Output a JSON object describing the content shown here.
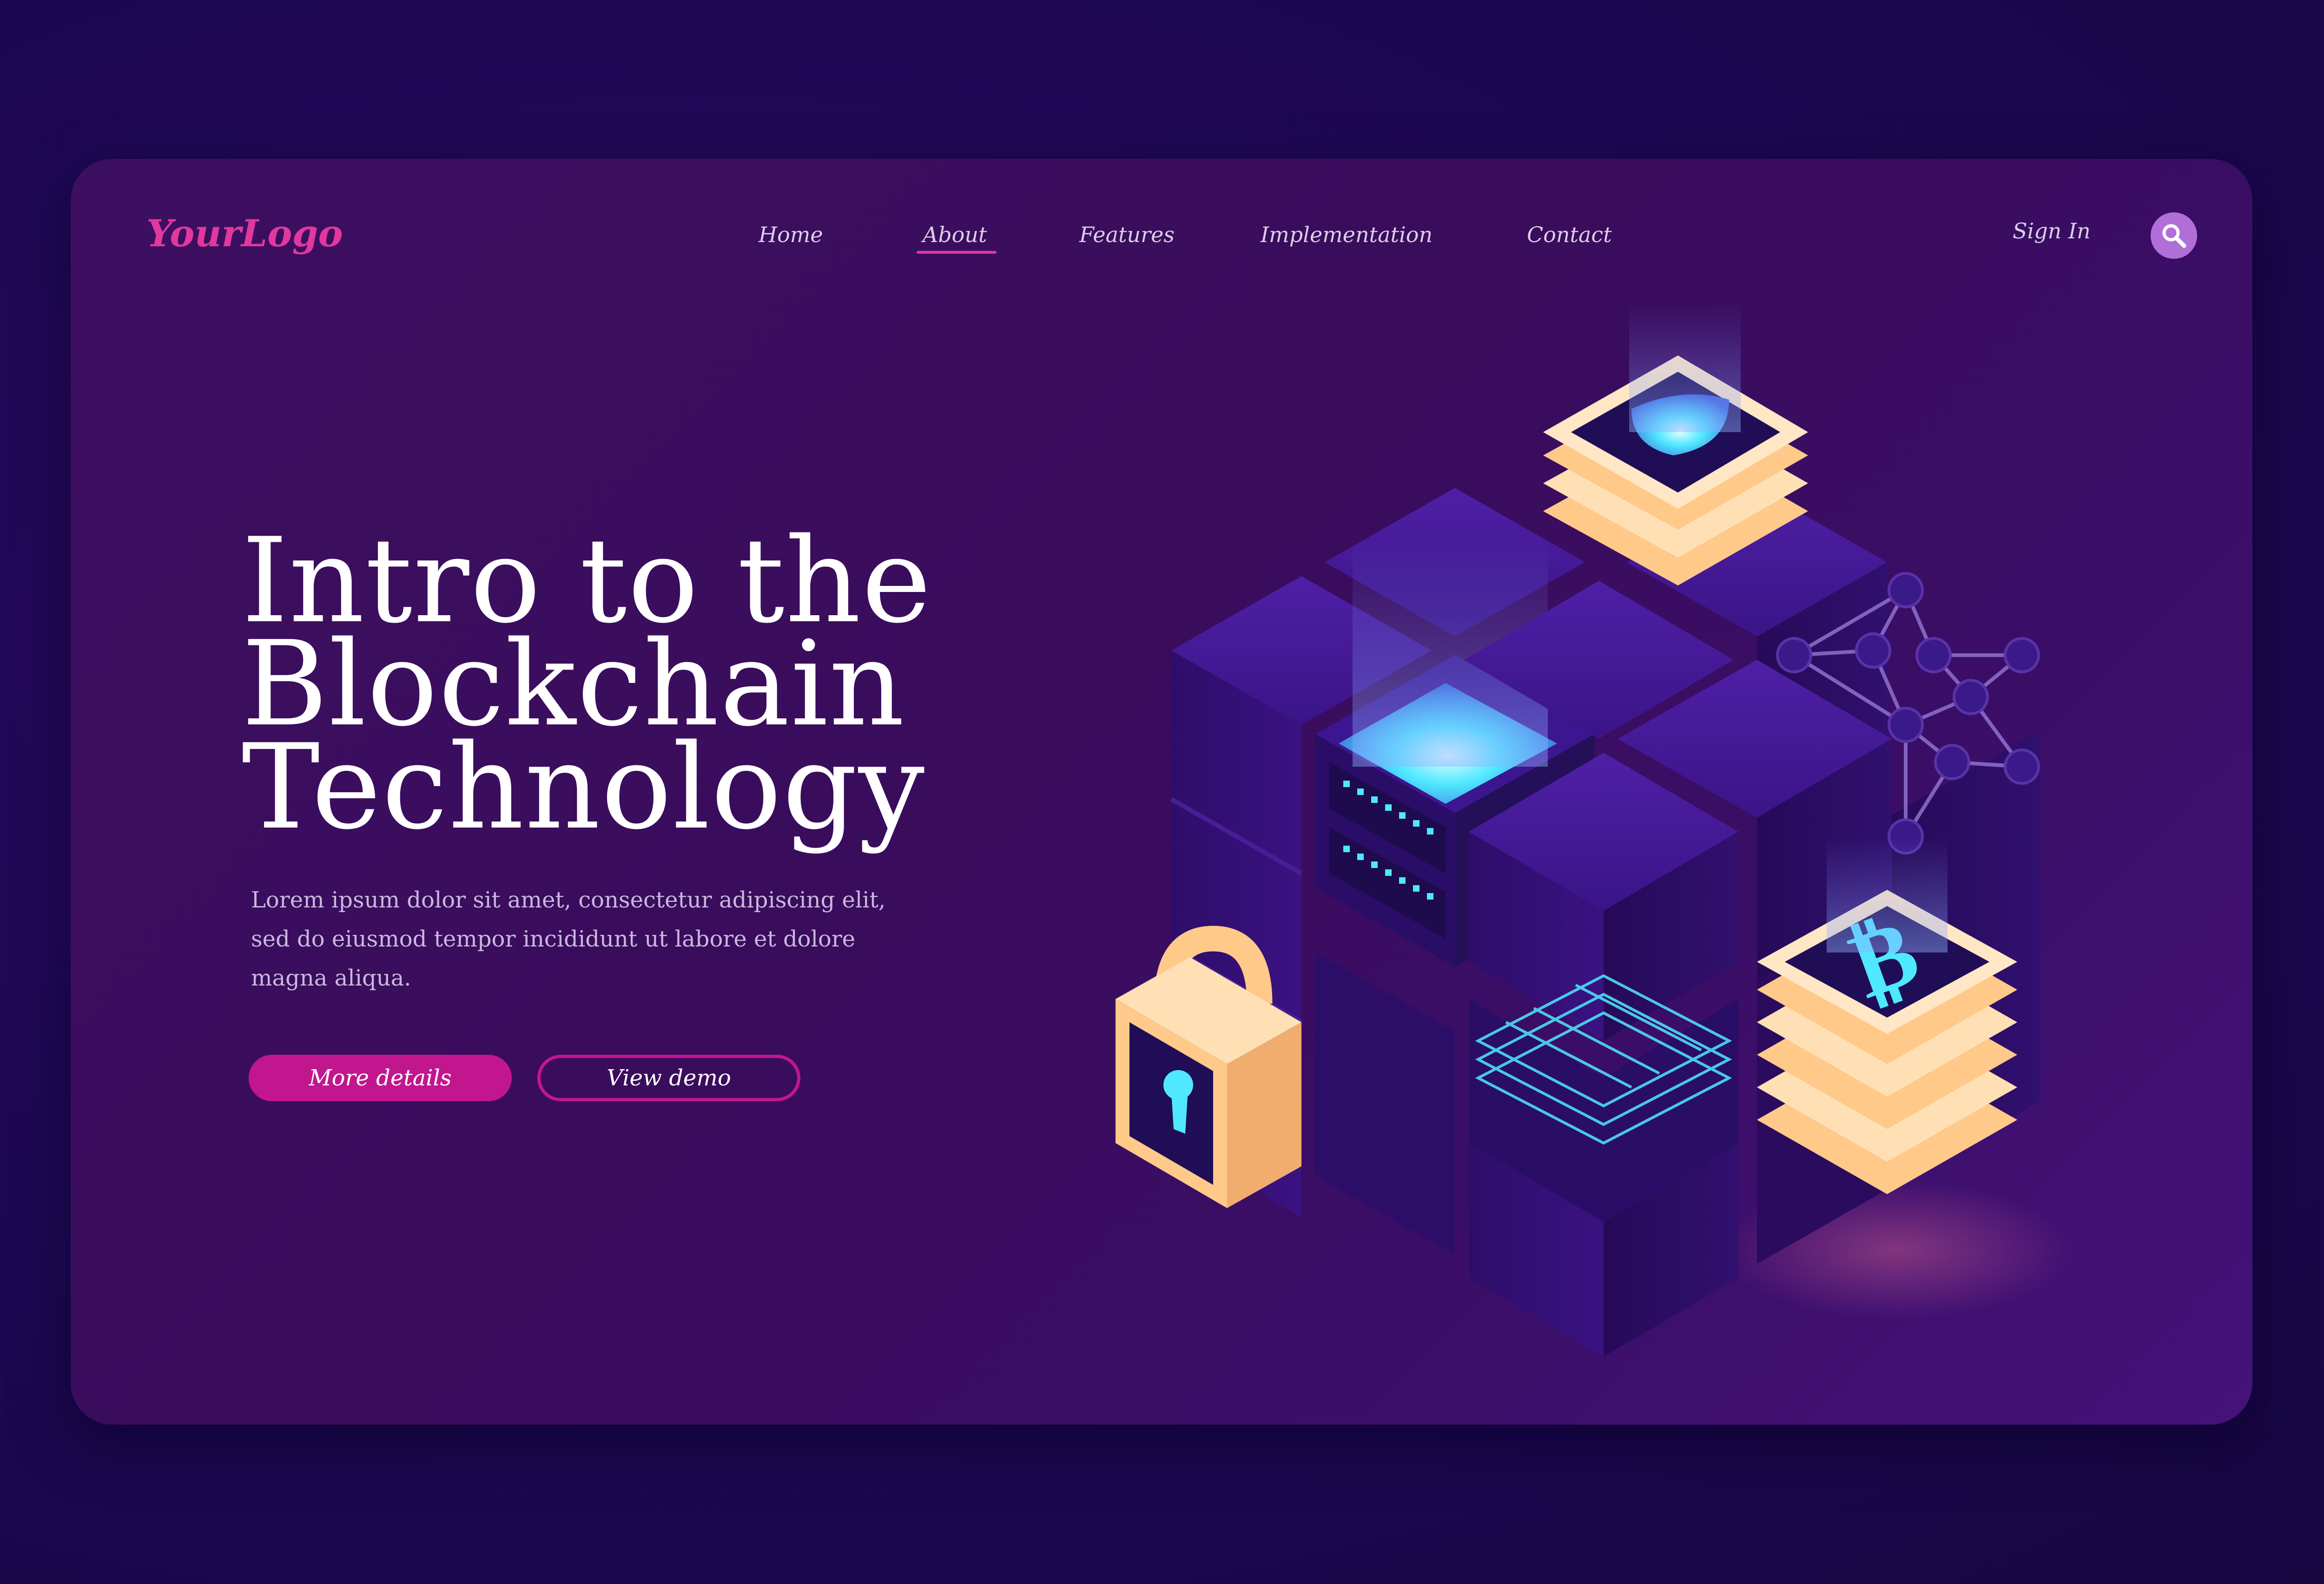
{
  "brand": {
    "logo_text": "YourLogo"
  },
  "nav": {
    "items": [
      {
        "label": "Home",
        "active": false
      },
      {
        "label": "About",
        "active": true
      },
      {
        "label": "Features",
        "active": false
      },
      {
        "label": "Implementation",
        "active": false
      },
      {
        "label": "Contact",
        "active": false
      }
    ],
    "sign_in_label": "Sign In",
    "search_icon": "search-icon"
  },
  "hero": {
    "title_lines": [
      "Intro to the",
      "Blockchain",
      "Technology"
    ],
    "description": "Lorem ipsum dolor sit amet, consectetur adipiscing elit, sed do eiusmod tempor incididunt ut labore et dolore magna aliqua.",
    "primary_button": "More details",
    "secondary_button": "View demo"
  },
  "colors": {
    "background": "#1c0852",
    "card": "#3d0f60",
    "accent": "#e0389e",
    "button": "#c2168f",
    "cube_top": "#4a1a9a",
    "glow": "#4fe8ff",
    "gold": "#ffcf96"
  },
  "illustration": {
    "icons": [
      "shield-icon",
      "server-icon",
      "padlock-icon",
      "bitcoin-icon",
      "network-icon",
      "circuit-icon"
    ]
  }
}
